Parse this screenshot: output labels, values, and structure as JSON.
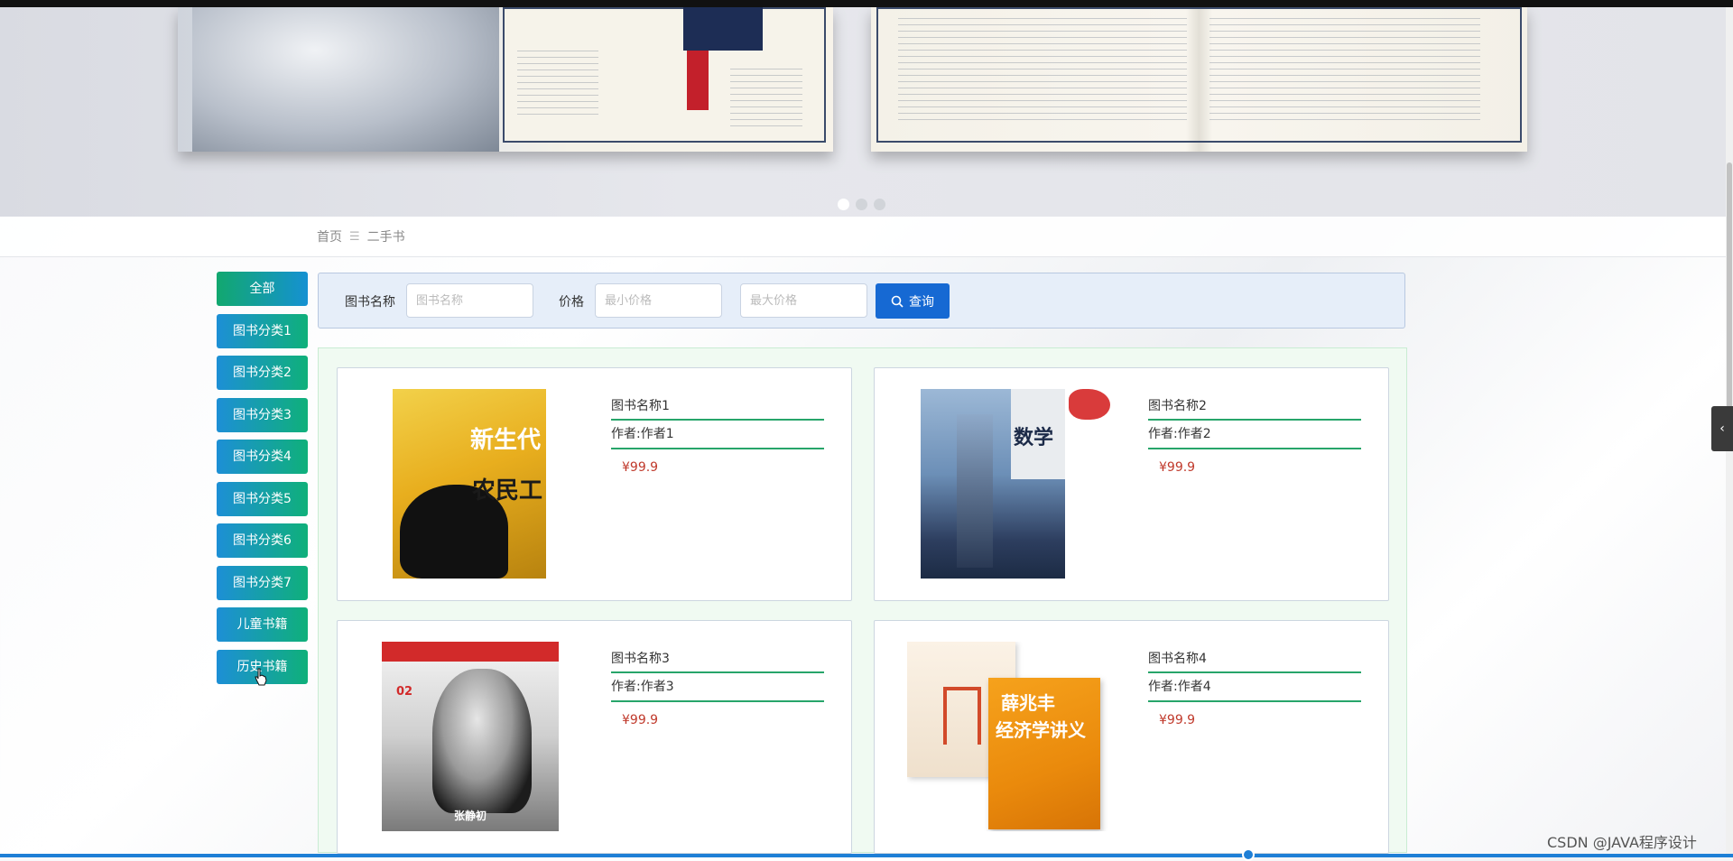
{
  "banner": {
    "dots": 3,
    "active_dot": 0
  },
  "breadcrumb": {
    "home": "首页",
    "separator": "☰",
    "current": "二手书"
  },
  "sidebar": {
    "categories": [
      "全部",
      "图书分类1",
      "图书分类2",
      "图书分类3",
      "图书分类4",
      "图书分类5",
      "图书分类6",
      "图书分类7",
      "儿童书籍",
      "历史书籍"
    ]
  },
  "search": {
    "name_label": "图书名称",
    "name_placeholder": "图书名称",
    "price_label": "价格",
    "min_price_placeholder": "最小价格",
    "max_price_placeholder": "最大价格",
    "button_label": "查询",
    "button_icon": "search-icon"
  },
  "products": [
    {
      "name": "图书名称1",
      "author": "作者:作者1",
      "price": "¥99.9",
      "cover_text": [
        "新生代",
        "农民工"
      ]
    },
    {
      "name": "图书名称2",
      "author": "作者:作者2",
      "price": "¥99.9",
      "cover_text": [
        "数学"
      ]
    },
    {
      "name": "图书名称3",
      "author": "作者:作者3",
      "price": "¥99.9",
      "cover_text": [
        "02",
        "张静初"
      ]
    },
    {
      "name": "图书名称4",
      "author": "作者:作者4",
      "price": "¥99.9",
      "cover_text": [
        "薛兆丰",
        "经济学讲义"
      ]
    }
  ],
  "side_tab": {
    "icon": "chevron-left-icon",
    "glyph": "‹"
  },
  "watermark": "CSDN @JAVA程序设计",
  "colors": {
    "primary": "#1669d3",
    "accent_green": "#27a56a",
    "price": "#c0392b"
  }
}
